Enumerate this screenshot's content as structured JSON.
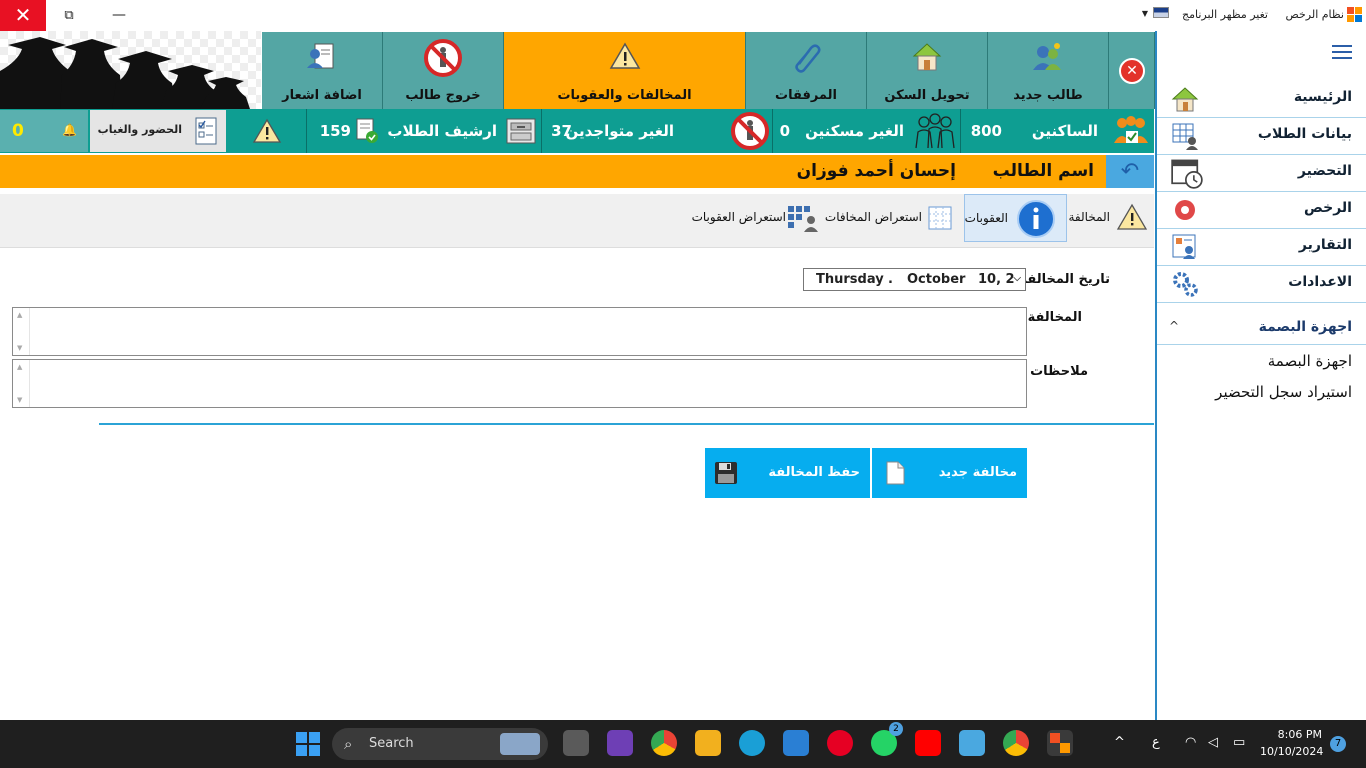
{
  "window": {
    "title": "نظام الرخص",
    "theme_menu": "تغير مظهر البرنامج",
    "close_glyph": "✕",
    "restore_glyph": "⧉",
    "minimize_glyph": "—"
  },
  "sidebar": {
    "items": [
      {
        "label": "الرئيسية",
        "icon": "home-icon"
      },
      {
        "label": "بيانات الطلاب",
        "icon": "students-data-icon"
      },
      {
        "label": "التحضير",
        "icon": "calendar-clock-icon"
      },
      {
        "label": "الرخص",
        "icon": "permit-record-icon"
      },
      {
        "label": "التقارير",
        "icon": "reports-icon"
      },
      {
        "label": "الاعدادات",
        "icon": "gears-icon"
      }
    ],
    "biometric": {
      "header": "اجهزة البصمة",
      "links": [
        "اجهزة البصمة",
        "استيراد سجل التحضير"
      ]
    }
  },
  "toolbar": {
    "tiles": [
      {
        "label": "طالب جديد",
        "icon": "new-student-icon"
      },
      {
        "label": "تحويل السكن",
        "icon": "house-icon"
      },
      {
        "label": "المرفقات",
        "icon": "paperclip-icon"
      },
      {
        "label": "المخالفات والعقوبات",
        "icon": "warning-icon"
      },
      {
        "label": "خروج طالب",
        "icon": "no-entry-icon"
      },
      {
        "label": "اضافة اشعار",
        "icon": "add-notice-icon"
      }
    ]
  },
  "stats": {
    "residents_label": "الساكنين",
    "residents_value": "800",
    "non_residents_label": "الغير مسكنين",
    "non_residents_value": "0",
    "absent_label": "الغير متواجدين",
    "absent_value": "37",
    "archive_label": "ارشيف الطلاب",
    "archive_value": "159",
    "attendance_label": "الحضور والغياب",
    "notifications_value": "0"
  },
  "student": {
    "name_label": "اسم الطالب",
    "name": "إحسان أحمد فوزان"
  },
  "tabs": [
    {
      "label": "المخالفة",
      "icon": "warning-icon"
    },
    {
      "label": "العقوبات",
      "icon": "info-icon"
    },
    {
      "label": "استعراض المخافات",
      "icon": "grid-icon"
    },
    {
      "label": "استعراض العقوبات",
      "icon": "user-grid-icon"
    }
  ],
  "form": {
    "date_label": "تاريخ المخالفة",
    "date_weekday": "Thursday",
    "date_sep": ".",
    "date_month": "October",
    "date_day": "10, 2",
    "violation_label": "المخالفة",
    "violation_value": "",
    "notes_label": "ملاحظات",
    "notes_value": ""
  },
  "actions": {
    "new_violation": "مخالفة جديد",
    "save_violation": "حفظ المخالفة"
  },
  "taskbar": {
    "search_label": "Search",
    "time": "8:06 PM",
    "date": "10/10/2024",
    "notification_count": "7",
    "whatsapp_badge": "2",
    "lang": "ع"
  },
  "colors": {
    "teal": "#54a6a4",
    "orange": "#ffa600",
    "blue_button": "#06adef",
    "stats_bg": "#0e9e92"
  }
}
